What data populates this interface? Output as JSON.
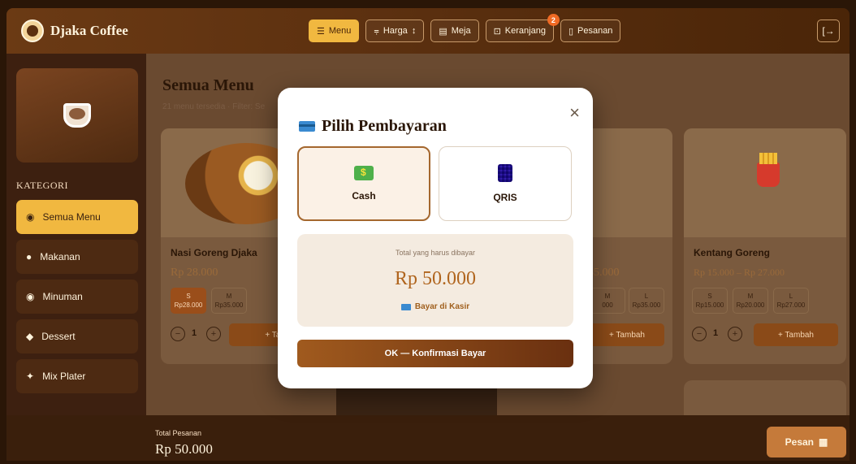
{
  "header": {
    "brand": "Djaka Coffee",
    "nav": [
      {
        "label": "Menu",
        "icon": "hamburger-icon",
        "active": true
      },
      {
        "label": "Harga",
        "icon": "sort-icon",
        "active": false
      },
      {
        "label": "Meja",
        "icon": "table-icon",
        "active": false
      },
      {
        "label": "Keranjang",
        "icon": "cart-icon",
        "active": false,
        "badge": "2"
      },
      {
        "label": "Pesanan",
        "icon": "clipboard-icon",
        "active": false
      }
    ],
    "logout_icon": "logout-icon"
  },
  "sidebar": {
    "heading": "KATEGORI",
    "items": [
      {
        "label": "Semua Menu",
        "active": true
      },
      {
        "label": "Makanan",
        "active": false
      },
      {
        "label": "Minuman",
        "active": false
      },
      {
        "label": "Dessert",
        "active": false
      },
      {
        "label": "Mix Plater",
        "active": false
      }
    ]
  },
  "main": {
    "title": "Semua Menu",
    "subtitle": "21 menu tersedia · Filter: Se",
    "cards": [
      {
        "name": "Nasi Goreng Djaka",
        "price": "Rp 28.000",
        "sizes": [
          {
            "label": "S",
            "price": "Rp28.000",
            "selected": true
          },
          {
            "label": "M",
            "price": "Rp35.000",
            "selected": false
          }
        ],
        "qty": "1",
        "add_label": "+ Tam"
      },
      {
        "name": "",
        "price": "35.000",
        "sizes": [
          {
            "label": "M",
            "price": "000",
            "selected": false
          },
          {
            "label": "L",
            "price": "Rp35.000",
            "selected": false
          }
        ],
        "qty": "",
        "add_label": "+ Tambah"
      },
      {
        "name": "Kentang Goreng",
        "price": "Rp 15.000 – Rp 27.000",
        "sizes": [
          {
            "label": "S",
            "price": "Rp15.000",
            "selected": false
          },
          {
            "label": "M",
            "price": "Rp20.000",
            "selected": false
          },
          {
            "label": "L",
            "price": "Rp27.000",
            "selected": false
          }
        ],
        "qty": "1",
        "add_label": "+ Tambah"
      }
    ]
  },
  "footer": {
    "label": "Total Pesanan",
    "total": "Rp 50.000",
    "order_button": "Pesan"
  },
  "modal": {
    "title": "Pilih Pembayaran",
    "close": "×",
    "options": [
      {
        "label": "Cash",
        "icon": "cash-icon",
        "selected": true
      },
      {
        "label": "QRIS",
        "icon": "qris-icon",
        "selected": false
      }
    ],
    "total_label": "Total yang harus dibayar",
    "total_amount": "Rp 50.000",
    "note": "Bayar di Kasir",
    "confirm_button": "OK — Konfirmasi Bayar"
  },
  "colors": {
    "accent": "#f1b840",
    "brand": "#6b3a14",
    "badge": "#f06a24"
  }
}
